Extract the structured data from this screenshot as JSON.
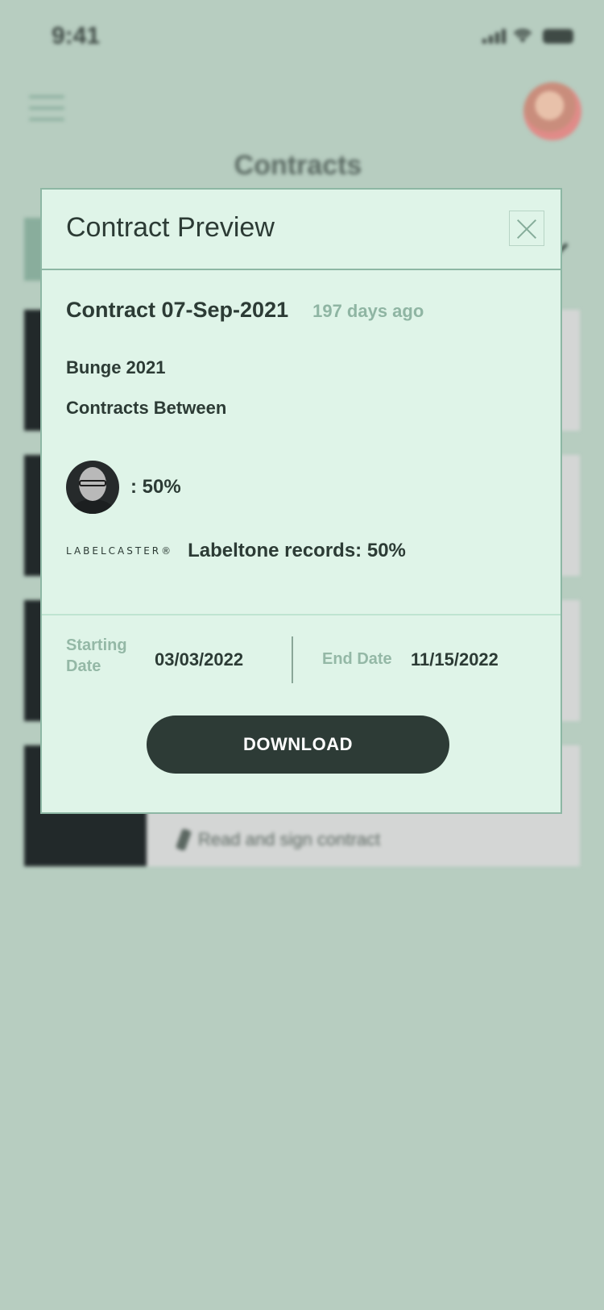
{
  "status_bar": {
    "time": "9:41"
  },
  "header": {
    "title": "Contracts"
  },
  "background": {
    "cards": [
      {
        "accent": "#2fbf5a"
      },
      {
        "accent": "#e45b4a"
      },
      {
        "accent": "#e7c42e"
      },
      {
        "action": "Read and sign contract"
      }
    ]
  },
  "modal": {
    "title": "Contract Preview",
    "contract_name": "Contract 07-Sep-2021",
    "age": "197 days ago",
    "party_name": "Bunge 2021",
    "contracts_between": "Contracts Between",
    "person_share": ": 50%",
    "logo_text": "LABELCASTER®",
    "logo_records": "Labeltone records: 50%",
    "starting_label": "Starting Date",
    "starting_value": "03/03/2022",
    "end_label": "End Date",
    "end_value": "11/15/2022",
    "download": "DOWNLOAD"
  }
}
